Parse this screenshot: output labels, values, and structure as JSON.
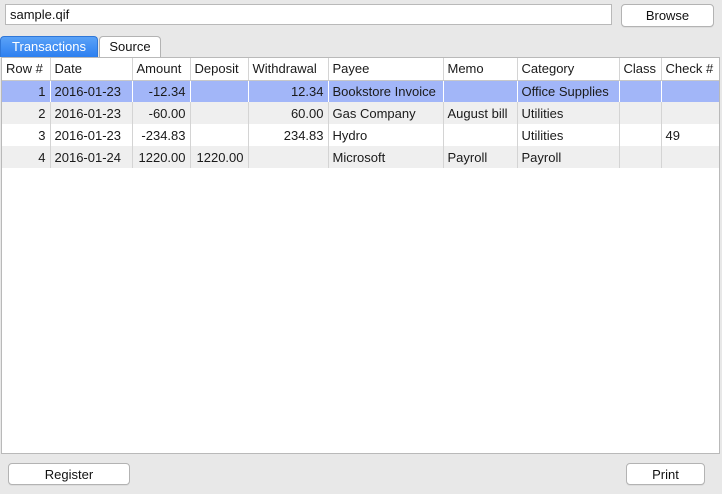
{
  "file": {
    "value": "sample.qif"
  },
  "buttons": {
    "browse": "Browse",
    "register": "Register",
    "print": "Print"
  },
  "tabs": [
    {
      "label": "Transactions",
      "active": true
    },
    {
      "label": "Source",
      "active": false
    }
  ],
  "table": {
    "columns": [
      "Row #",
      "Date",
      "Amount",
      "Deposit",
      "Withdrawal",
      "Payee",
      "Memo",
      "Category",
      "Class",
      "Check #"
    ],
    "rows": [
      [
        "1",
        "2016-01-23",
        "-12.34",
        "",
        "12.34",
        "Bookstore Invoice",
        "",
        "Office Supplies",
        "",
        ""
      ],
      [
        "2",
        "2016-01-23",
        "-60.00",
        "",
        "60.00",
        "Gas Company",
        "August bill",
        "Utilities",
        "",
        ""
      ],
      [
        "3",
        "2016-01-23",
        "-234.83",
        "",
        "234.83",
        "Hydro",
        "",
        "Utilities",
        "",
        "49"
      ],
      [
        "4",
        "2016-01-24",
        "1220.00",
        "1220.00",
        "",
        "Microsoft",
        "Payroll",
        "Payroll",
        "",
        ""
      ]
    ],
    "selected_row": 1
  },
  "colors": {
    "accent": "#2d7ff0",
    "selection": "#a2b6f8",
    "alt_row": "#efefef"
  }
}
